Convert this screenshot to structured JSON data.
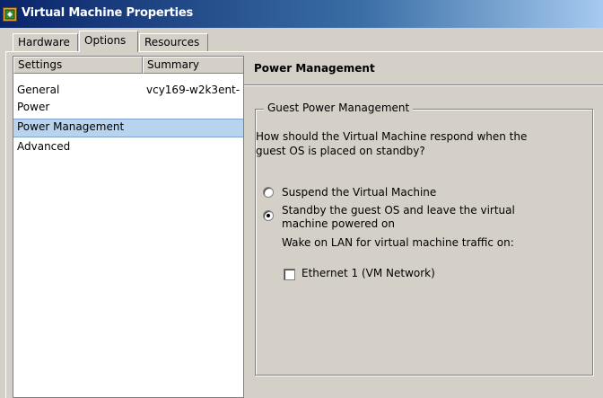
{
  "window": {
    "title": "Virtual Machine Properties"
  },
  "tabs": [
    {
      "label": "Hardware"
    },
    {
      "label": "Options"
    },
    {
      "label": "Resources"
    }
  ],
  "list": {
    "columns": [
      "Settings",
      "Summary"
    ],
    "rows": [
      {
        "setting": "General",
        "summary": "vcy169-w2k3ent-"
      },
      {
        "setting": "Power",
        "summary": ""
      },
      {
        "setting": "Power Management",
        "summary": ""
      },
      {
        "setting": "Advanced",
        "summary": ""
      }
    ],
    "selected_index": 2
  },
  "detail": {
    "title": "Power Management",
    "group_label": "Guest Power Management",
    "question": "How should the Virtual Machine respond when the guest OS is placed on standby?",
    "question_line1": "How should the Virtual Machine respond when the",
    "question_line2": "guest OS is placed on standby?",
    "option_suspend": "Suspend the Virtual Machine",
    "option_standby_line1": "Standby the guest OS and leave the virtual",
    "option_standby_line2": "machine powered on",
    "selected_option": "standby",
    "wol_label": "Wake on LAN for virtual machine traffic on:",
    "ethernet_label": "Ethernet 1 (VM Network)",
    "ethernet_checked": false
  },
  "colors": {
    "selection": "#b7d3ee",
    "titlebar_start": "#0a246a",
    "face": "#d4d0c8"
  }
}
